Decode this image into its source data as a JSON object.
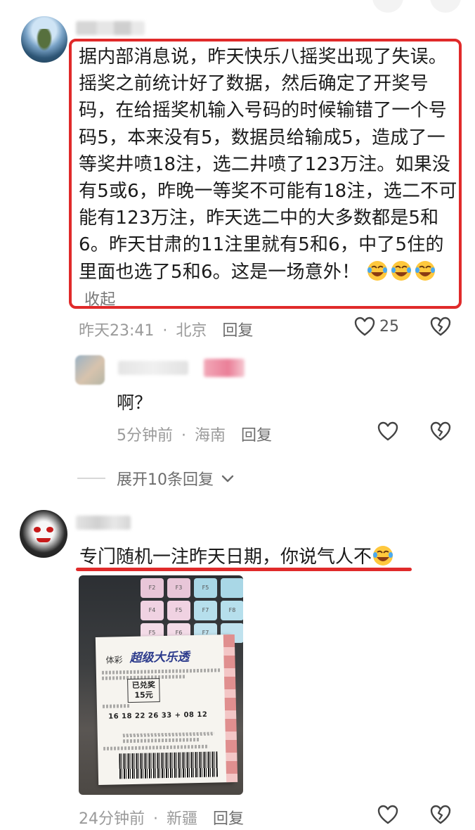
{
  "comments": [
    {
      "text": "据内部消息说，昨天快乐八摇奖出现了失误。摇奖之前统计好了数据，然后确定了开奖号码，在给摇奖机输入号码的时候输错了一个号码5，本来没有5，数据员给输成5，造成了一等奖井喷18注，选二井喷了123万注。如果没有5或6，昨晚一等奖不可能有18注，选二不可能有123万注，昨天选二中的大多数都是5和6。昨天甘肃的11注里就有5和6，中了5住的里面也选了5和6。这是一场意外！",
      "emoji_icon": "rolling-laughing-face",
      "collapse_label": "收起",
      "time": "昨天23:41",
      "location": "北京",
      "reply_label": "回复",
      "like_count": "25",
      "highlight_color": "#e02a2a"
    },
    {
      "text": "啊？",
      "time": "5分钟前",
      "location": "海南",
      "reply_label": "回复"
    },
    {
      "text": "专门随机一注昨天日期，你说气人不",
      "emoji_icon": "rolling-laughing-face",
      "time": "24分钟前",
      "location": "新疆",
      "reply_label": "回复"
    }
  ],
  "expand_replies_label": "展开10条回复",
  "separator_dot": "·",
  "ticket": {
    "brand": "超级大乐透",
    "sub": "体彩",
    "stamp": "已兑奖\n15元",
    "numbers": "16  18  22  26  33  +  08  12"
  }
}
